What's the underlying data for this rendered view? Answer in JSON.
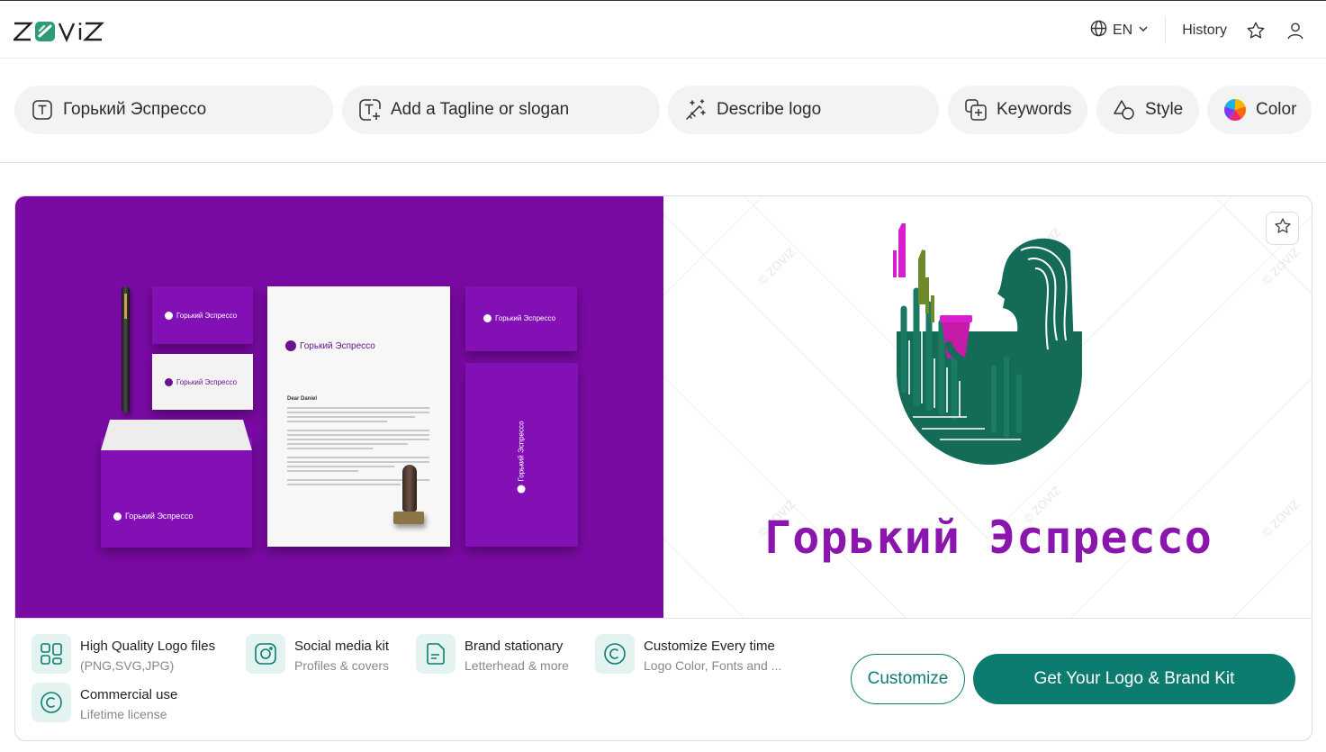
{
  "header": {
    "brand": "ZOVIZ",
    "lang": "EN",
    "history_label": "History"
  },
  "inputs": {
    "name_value": "Горький Эспрессо",
    "tagline_placeholder": "Add a Tagline or slogan",
    "describe_placeholder": "Describe logo",
    "keywords_label": "Keywords",
    "style_label": "Style",
    "color_label": "Color"
  },
  "mockup": {
    "brand_text": "Горький Эспрессо",
    "letter_greeting": "Dear Daniel"
  },
  "preview": {
    "brand_name": "Горький Эспрессо",
    "watermark": "© ZOVIZ"
  },
  "features": [
    {
      "title": "High Quality Logo files",
      "sub": "(PNG,SVG,JPG)"
    },
    {
      "title": "Social media kit",
      "sub": "Profiles & covers"
    },
    {
      "title": "Brand stationary",
      "sub": "Letterhead & more"
    },
    {
      "title": "Customize Every time",
      "sub": "Logo Color, Fonts and ..."
    },
    {
      "title": "Commercial use",
      "sub": "Lifetime license"
    }
  ],
  "actions": {
    "customize_label": "Customize",
    "get_label": "Get Your Logo & Brand Kit"
  },
  "colors": {
    "accent": "#0d7c70",
    "brand_purple": "#8a16ae",
    "mockup_bg": "#7a0aa4"
  }
}
